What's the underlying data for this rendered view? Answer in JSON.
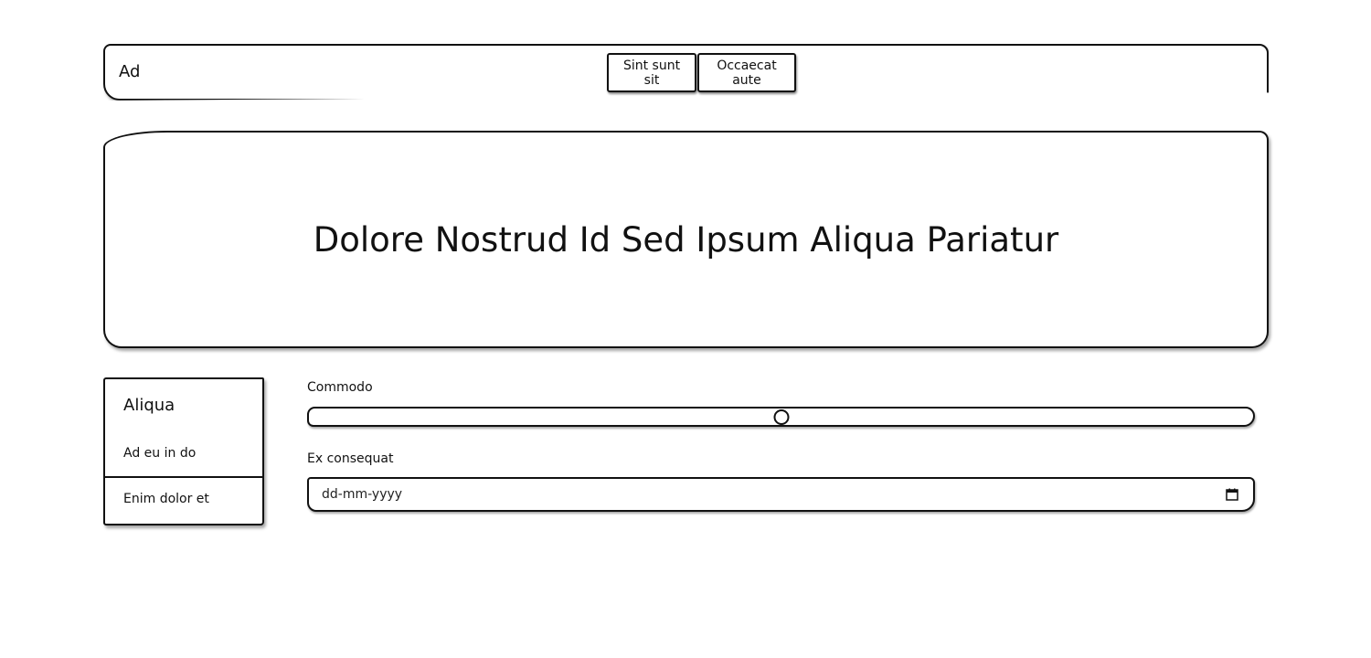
{
  "navbar": {
    "brand": "Ad",
    "buttons": [
      {
        "label": "Sint sunt sit"
      },
      {
        "label": "Occaecat aute"
      }
    ]
  },
  "hero": {
    "title": "Dolore Nostrud Id Sed Ipsum Aliqua Pariatur"
  },
  "sidebar": {
    "heading": "Aliqua",
    "items": [
      {
        "label": "Ad eu in do"
      },
      {
        "label": "Enim dolor et"
      }
    ]
  },
  "form": {
    "range": {
      "label": "Commodo",
      "value_fraction": 0.5
    },
    "date": {
      "label": "Ex consequat",
      "placeholder": "dd-mm-yyyy",
      "icon": "calendar-icon"
    }
  }
}
